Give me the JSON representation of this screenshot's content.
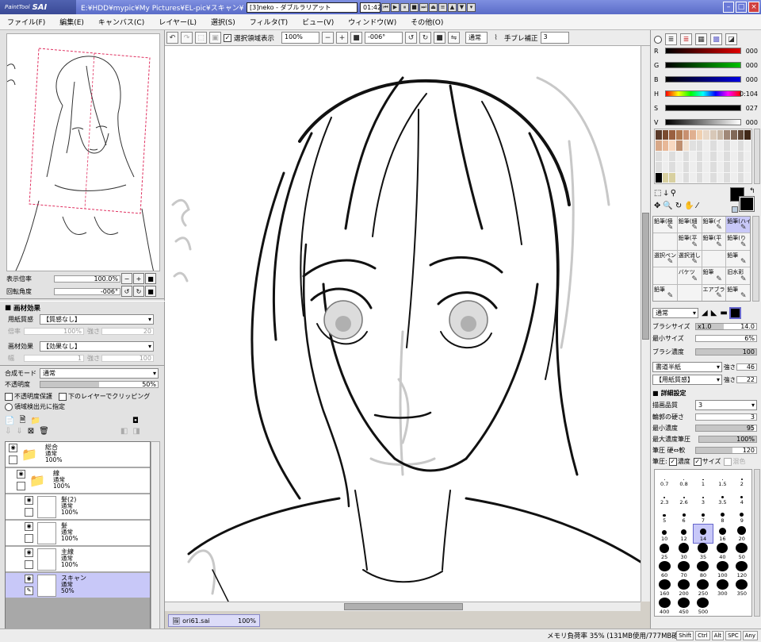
{
  "title": {
    "logo_small": "PaintTool",
    "logo_big": "SAI",
    "path": "E:¥HDD¥mypic¥My Pictures¥EL-pic¥スキャン¥ori61",
    "playlist": "[3]neko - ダブルラリアット",
    "time": "01:42"
  },
  "menu": [
    "ファイル(F)",
    "編集(E)",
    "キャンバス(C)",
    "レイヤー(L)",
    "選択(S)",
    "フィルタ(T)",
    "ビュー(V)",
    "ウィンドウ(W)",
    "その他(O)"
  ],
  "toolbar": {
    "selection_label": "選択領域表示",
    "zoom": "100%",
    "angle": "-006°",
    "blend_mode": "通常",
    "stabilizer_label": "手ブレ補正",
    "stabilizer_value": "3"
  },
  "navigator": {
    "zoom_label": "表示倍率",
    "zoom_value": "100.0%",
    "angle_label": "回転角度",
    "angle_value": "-006°"
  },
  "effects": {
    "header": "画材効果",
    "paper_label": "用紙質感",
    "paper_value": "【質感なし】",
    "paper_scale_label": "倍率",
    "paper_scale_value": "100%",
    "paper_strength_label": "強さ",
    "paper_strength_value": "20",
    "effect_label": "画材効果",
    "effect_value": "【効果なし】",
    "effect_width_label": "幅",
    "effect_width_value": "1",
    "effect_strength_label": "強さ",
    "effect_strength_value": "100"
  },
  "layer_props": {
    "mode_label": "合成モード",
    "mode_value": "通常",
    "opacity_label": "不透明度",
    "opacity_value": "50%",
    "opacity_fraction": 0.5,
    "protect_label": "不透明度保護",
    "clip_label": "下のレイヤーでクリッピング",
    "source_label": "領域検出元に指定"
  },
  "layers": [
    {
      "name": "総合",
      "mode": "通常",
      "opacity": "100%",
      "indent": 0,
      "folder": true,
      "selected": false
    },
    {
      "name": "線",
      "mode": "通常",
      "opacity": "100%",
      "indent": 1,
      "folder": true,
      "selected": false
    },
    {
      "name": "髪(2)",
      "mode": "通常",
      "opacity": "100%",
      "indent": 2,
      "folder": false,
      "selected": false
    },
    {
      "name": "髪",
      "mode": "通常",
      "opacity": "100%",
      "indent": 2,
      "folder": false,
      "selected": false
    },
    {
      "name": "主線",
      "mode": "通常",
      "opacity": "100%",
      "indent": 2,
      "folder": false,
      "selected": false
    },
    {
      "name": "スキャン",
      "mode": "通常",
      "opacity": "50%",
      "indent": 2,
      "folder": false,
      "selected": true
    }
  ],
  "document_tab": {
    "name": "ori61.sai",
    "zoom": "100%"
  },
  "status": {
    "memory": "メモリ負荷率 35% (131MB使用/777MB確保)",
    "keys": [
      "Shift",
      "Ctrl",
      "Alt",
      "SPC",
      "Any"
    ]
  },
  "color": {
    "r": "000",
    "g": "000",
    "b": "000",
    "h": "0:104",
    "s": "027",
    "v": "000",
    "colors": {
      "red": "#e00000",
      "green": "#00c000",
      "blue": "#0000e0",
      "sel": "#c8c8f8"
    }
  },
  "tools": [
    {
      "label": "鉛筆(極",
      "sel": false
    },
    {
      "label": "鉛筆(細",
      "sel": false
    },
    {
      "label": "鉛筆(イ",
      "sel": false
    },
    {
      "label": "鉛筆(ハイ",
      "sel": true
    },
    {
      "label": "",
      "sel": false
    },
    {
      "label": "鉛筆(平",
      "sel": false
    },
    {
      "label": "鉛筆(平",
      "sel": false
    },
    {
      "label": "鉛筆(り",
      "sel": false
    },
    {
      "label": "選択ペン",
      "sel": false
    },
    {
      "label": "選択消し",
      "sel": false
    },
    {
      "label": "",
      "sel": false
    },
    {
      "label": "鉛筆",
      "sel": false
    },
    {
      "label": "",
      "sel": false
    },
    {
      "label": "バケツ",
      "sel": false
    },
    {
      "label": "鉛筆",
      "sel": false
    },
    {
      "label": "旧水彩",
      "sel": false
    },
    {
      "label": "鉛筆",
      "sel": false
    },
    {
      "label": "",
      "sel": false
    },
    {
      "label": "エアブラシ",
      "sel": false
    },
    {
      "label": "鉛筆",
      "sel": false
    }
  ],
  "brush": {
    "mode": "通常",
    "size_label": "ブラシサイズ",
    "size_mult": "x1.0",
    "size_value": "14.0",
    "min_size_label": "最小サイズ",
    "min_size_value": "6%",
    "density_label": "ブラシ濃度",
    "density_value": "100",
    "shape_value": "書道半紙",
    "shape_strength_label": "強さ",
    "shape_strength_value": "46",
    "texture_value": "【用紙質感】",
    "texture_strength_label": "強さ",
    "texture_strength_value": "22",
    "detail_header": "詳細設定",
    "quality_label": "描画品質",
    "quality_value": "3",
    "hardness_label": "輪郭の硬さ",
    "hardness_value": "3",
    "min_density_label": "最小濃度",
    "min_density_value": "95",
    "max_press_label": "最大濃度筆圧",
    "max_press_value": "100%",
    "press_label": "筆圧 硬⇔軟",
    "press_value": "120",
    "press_opts_label": "筆圧:",
    "press_density": "濃度",
    "press_size": "サイズ",
    "press_blend": "混色"
  },
  "brush_sizes": [
    {
      "label": "0.7",
      "d": 1,
      "sel": false
    },
    {
      "label": "0.8",
      "d": 1,
      "sel": false
    },
    {
      "label": "1",
      "d": 1.2,
      "sel": false
    },
    {
      "label": "1.5",
      "d": 1.5,
      "sel": false
    },
    {
      "label": "2",
      "d": 2,
      "sel": false
    },
    {
      "label": "2.3",
      "d": 2,
      "sel": false
    },
    {
      "label": "2.6",
      "d": 2,
      "sel": false
    },
    {
      "label": "3",
      "d": 2.5,
      "sel": false
    },
    {
      "label": "3.5",
      "d": 3,
      "sel": false
    },
    {
      "label": "4",
      "d": 3,
      "sel": false
    },
    {
      "label": "5",
      "d": 3.5,
      "sel": false
    },
    {
      "label": "6",
      "d": 4,
      "sel": false
    },
    {
      "label": "7",
      "d": 4,
      "sel": false
    },
    {
      "label": "8",
      "d": 5,
      "sel": false
    },
    {
      "label": "9",
      "d": 5,
      "sel": false
    },
    {
      "label": "10",
      "d": 6,
      "sel": false
    },
    {
      "label": "12",
      "d": 7,
      "sel": false
    },
    {
      "label": "14",
      "d": 8,
      "sel": true
    },
    {
      "label": "16",
      "d": 9,
      "sel": false
    },
    {
      "label": "20",
      "d": 11,
      "sel": false
    },
    {
      "label": "25",
      "d": 12,
      "sel": false
    },
    {
      "label": "30",
      "d": 13,
      "sel": false
    },
    {
      "label": "35",
      "d": 13,
      "sel": false
    },
    {
      "label": "40",
      "d": 14,
      "sel": false
    },
    {
      "label": "50",
      "d": 15,
      "sel": false
    },
    {
      "label": "60",
      "d": 15,
      "sel": false
    },
    {
      "label": "70",
      "d": 15,
      "sel": false
    },
    {
      "label": "80",
      "d": 15,
      "sel": false
    },
    {
      "label": "100",
      "d": 15,
      "sel": false
    },
    {
      "label": "120",
      "d": 15,
      "sel": false
    },
    {
      "label": "160",
      "d": 15,
      "sel": false
    },
    {
      "label": "200",
      "d": 15,
      "sel": false
    },
    {
      "label": "250",
      "d": 15,
      "sel": false
    },
    {
      "label": "300",
      "d": 15,
      "sel": false
    },
    {
      "label": "350",
      "d": 15,
      "sel": false
    },
    {
      "label": "400",
      "d": 15,
      "sel": false
    },
    {
      "label": "450",
      "d": 15,
      "sel": false
    },
    {
      "label": "500",
      "d": 15,
      "sel": false
    }
  ]
}
